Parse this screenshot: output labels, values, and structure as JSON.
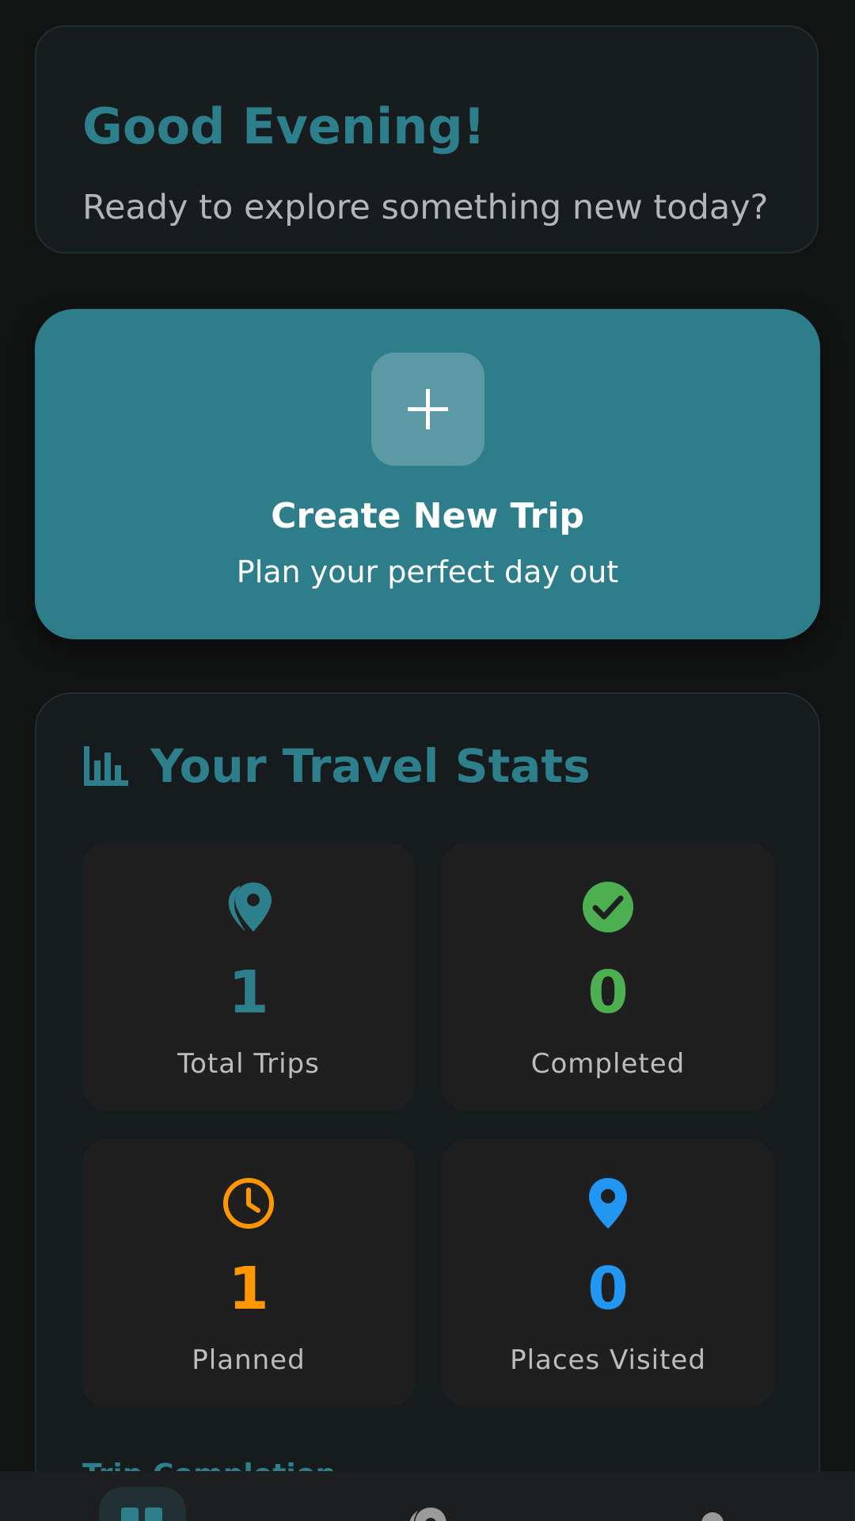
{
  "greeting": {
    "title": "Good Evening!",
    "subtitle": "Ready to explore something new today?"
  },
  "create_trip": {
    "title": "Create New Trip",
    "subtitle": "Plan your perfect day out",
    "icon": "plus-icon"
  },
  "stats": {
    "title": "Your Travel Stats",
    "icon": "bar-chart-icon",
    "tiles": [
      {
        "value": "1",
        "label": "Total Trips",
        "icon": "map-pin-outline-icon",
        "color": "#2e7f8c"
      },
      {
        "value": "0",
        "label": "Completed",
        "icon": "check-circle-icon",
        "color": "#4caf50"
      },
      {
        "value": "1",
        "label": "Planned",
        "icon": "clock-icon",
        "color": "#ff9800"
      },
      {
        "value": "0",
        "label": "Places Visited",
        "icon": "location-pin-icon",
        "color": "#2196f3"
      }
    ],
    "next_section": "Trip Completion"
  },
  "nav": {
    "items": [
      "home-icon",
      "map-icon",
      "profile-icon"
    ],
    "active_color": "#2e7f8c"
  },
  "colors": {
    "background": "#121313",
    "accent": "#2e7d8b",
    "card": "#171c1e",
    "tile": "#1f1f1f"
  }
}
